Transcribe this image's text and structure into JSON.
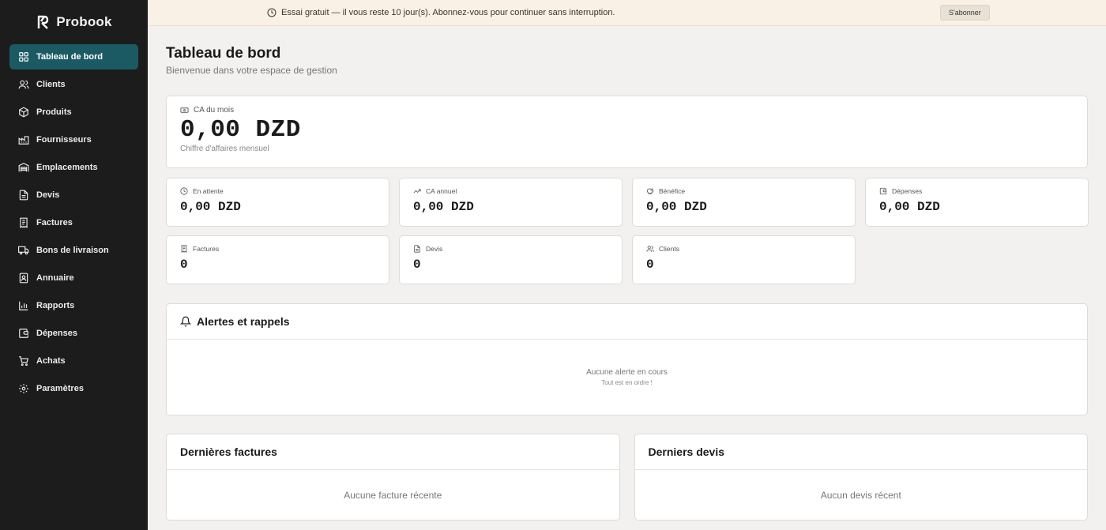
{
  "brand": {
    "name": "Probook"
  },
  "sidebar": {
    "items": [
      {
        "label": "Tableau de bord",
        "icon": "dashboard-icon",
        "active": true
      },
      {
        "label": "Clients",
        "icon": "users-icon"
      },
      {
        "label": "Produits",
        "icon": "box-icon"
      },
      {
        "label": "Fournisseurs",
        "icon": "factory-icon"
      },
      {
        "label": "Emplacements",
        "icon": "warehouse-icon"
      },
      {
        "label": "Devis",
        "icon": "document-icon"
      },
      {
        "label": "Factures",
        "icon": "receipt-icon"
      },
      {
        "label": "Bons de livraison",
        "icon": "truck-icon"
      },
      {
        "label": "Annuaire",
        "icon": "contact-book-icon"
      },
      {
        "label": "Rapports",
        "icon": "bar-chart-icon"
      },
      {
        "label": "Dépenses",
        "icon": "wallet-icon"
      },
      {
        "label": "Achats",
        "icon": "cart-icon"
      },
      {
        "label": "Paramètres",
        "icon": "gear-icon"
      }
    ]
  },
  "banner": {
    "text": "Essai gratuit — il vous reste 10 jour(s). Abonnez-vous pour continuer sans interruption.",
    "button": "S'abonner"
  },
  "header": {
    "title": "Tableau de bord",
    "subtitle": "Bienvenue dans votre espace de gestion"
  },
  "hero": {
    "label": "CA du mois",
    "value": "0,00 DZD",
    "caption": "Chiffre d'affaires mensuel"
  },
  "stats": [
    {
      "label": "En attente",
      "value": "0,00 DZD",
      "icon": "clock-icon"
    },
    {
      "label": "CA annuel",
      "value": "0,00 DZD",
      "icon": "trend-up-icon"
    },
    {
      "label": "Bénéfice",
      "value": "0,00 DZD",
      "icon": "piggy-bank-icon"
    },
    {
      "label": "Dépenses",
      "value": "0,00 DZD",
      "icon": "wallet-icon"
    },
    {
      "label": "Factures",
      "value": "0",
      "icon": "receipt-icon"
    },
    {
      "label": "Devis",
      "value": "0",
      "icon": "document-icon"
    },
    {
      "label": "Clients",
      "value": "0",
      "icon": "users-icon"
    }
  ],
  "alerts": {
    "title": "Alertes et rappels",
    "empty_title": "Aucune alerte en cours",
    "empty_sub": "Tout est en ordre !"
  },
  "recent_invoices": {
    "title": "Dernières factures",
    "empty": "Aucune facture récente"
  },
  "recent_quotes": {
    "title": "Derniers devis",
    "empty": "Aucun devis récent"
  },
  "colors": {
    "sidebar_bg": "#1c1c1c",
    "active_item": "#1c5a63",
    "banner_bg": "#faf1e6",
    "page_bg": "#f2f1ef"
  }
}
